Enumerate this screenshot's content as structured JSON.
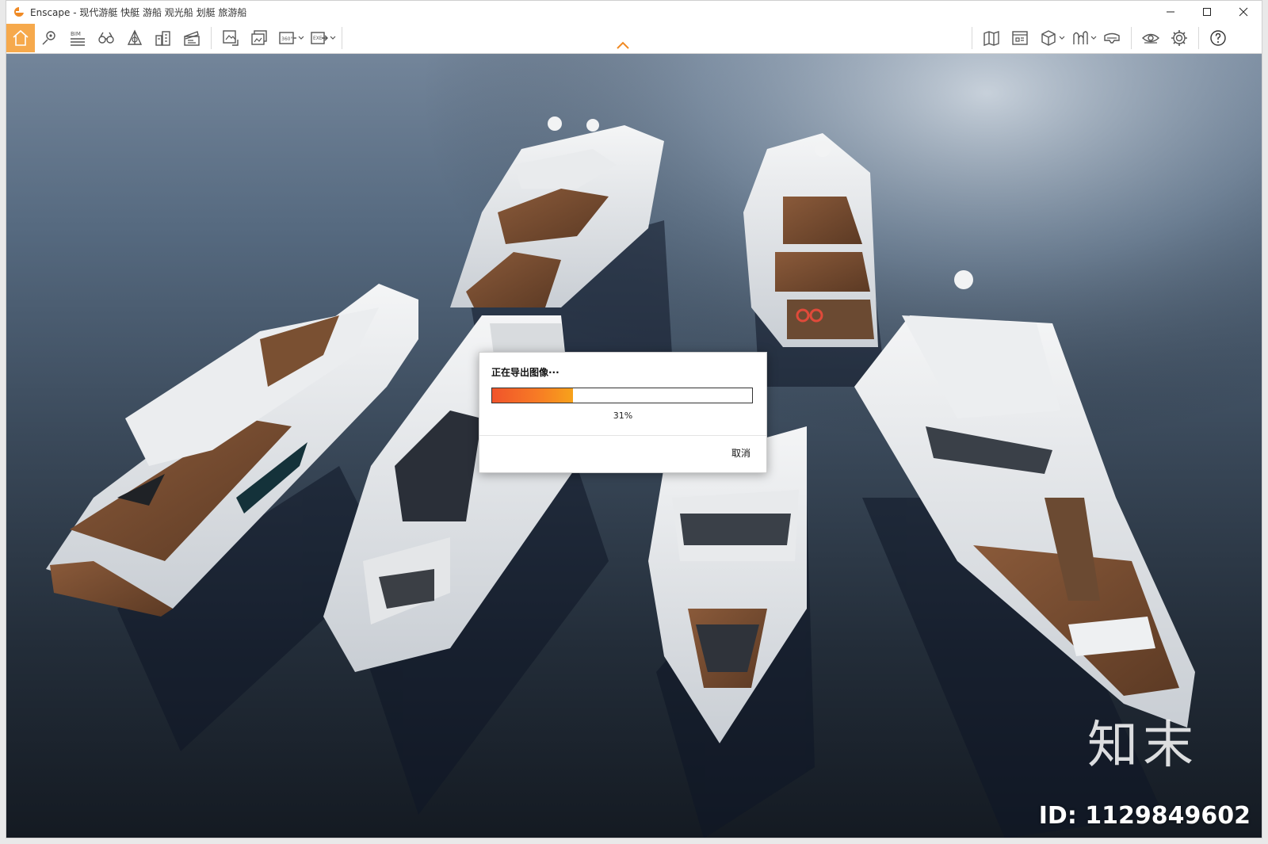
{
  "window": {
    "title": "Enscape - 现代游艇 快艇 游船 观光船 划艇 旅游船",
    "controls": [
      "minimize",
      "maximize",
      "close"
    ]
  },
  "toolbar": {
    "left_icons": [
      "home-icon",
      "map-pin-icon",
      "bim-icon",
      "binoculars-icon",
      "perspective-icon",
      "buildings-icon",
      "clapperboard-icon",
      "screenshot-export-icon",
      "batch-render-icon",
      "panorama-360-icon",
      "export-exe-icon"
    ],
    "right_icons": [
      "map-icon",
      "asset-library-icon",
      "view-cube-icon",
      "material-editor-icon",
      "vr-headset-icon",
      "visual-settings-icon",
      "settings-gear-icon",
      "help-icon"
    ],
    "bim_label": "BIM",
    "pano_label": "360°",
    "exe_label": "EXE",
    "accent_color": "#f6a94c"
  },
  "dialog": {
    "title": "正在导出图像···",
    "progress_value": 0.31,
    "progress_text": "31%",
    "cancel_label": "取消"
  },
  "watermark": {
    "logo_text": "知末",
    "id_text": "ID: 1129849602"
  }
}
